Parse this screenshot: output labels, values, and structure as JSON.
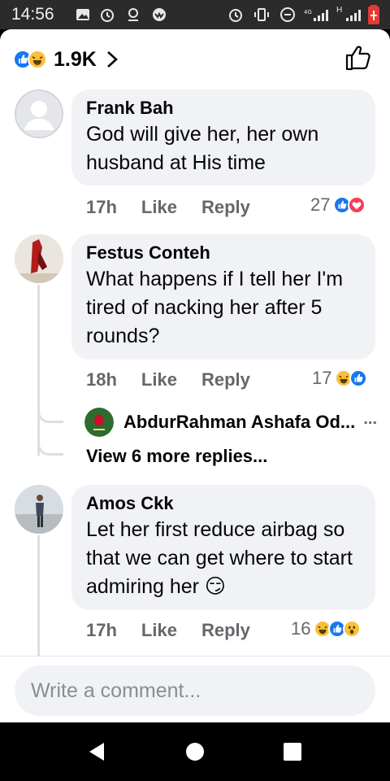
{
  "status_bar": {
    "time": "14:56",
    "network_label": "H",
    "icons_left": [
      "gallery-icon",
      "alarm-icon",
      "location-icon",
      "app-icon"
    ],
    "icons_right": [
      "alarm-icon",
      "vibrate-icon",
      "dnd-icon",
      "signal-icon",
      "signal-icon",
      "battery-icon"
    ]
  },
  "header": {
    "reaction_count": "1.9K",
    "reaction_icons": [
      "like-reaction",
      "haha-reaction"
    ]
  },
  "comments": [
    {
      "author": "Frank Bah",
      "text": "God will give her, her own husband at His time",
      "time": "17h",
      "like_label": "Like",
      "reply_label": "Reply",
      "reaction_count": "27",
      "reactions": [
        "like",
        "love"
      ]
    },
    {
      "author": "Festus Conteh",
      "text": "What happens if I tell her I'm tired of nacking her after 5 rounds?",
      "time": "18h",
      "like_label": "Like",
      "reply_label": "Reply",
      "reaction_count": "17",
      "reactions": [
        "haha",
        "like"
      ],
      "reply_preview": {
        "author": "AbdurRahman Ashafa Od...",
        "more": "..."
      },
      "view_more": "View 6 more replies..."
    },
    {
      "author": "Amos Ckk",
      "text": "Let her first reduce airbag so that we can get where to start admiring her 😏",
      "time": "17h",
      "like_label": "Like",
      "reply_label": "Reply",
      "reaction_count": "16",
      "reactions": [
        "haha",
        "like",
        "wow"
      ]
    }
  ],
  "composer": {
    "placeholder": "Write a comment..."
  },
  "nav": {
    "buttons": [
      "back-icon",
      "home-icon",
      "recents-icon"
    ]
  },
  "colors": {
    "like_blue": "#1877f2",
    "love_red": "#f33e58",
    "haha_yellow": "#f7c23a",
    "bubble_bg": "#f0f2f5",
    "muted_text": "#65676b"
  }
}
